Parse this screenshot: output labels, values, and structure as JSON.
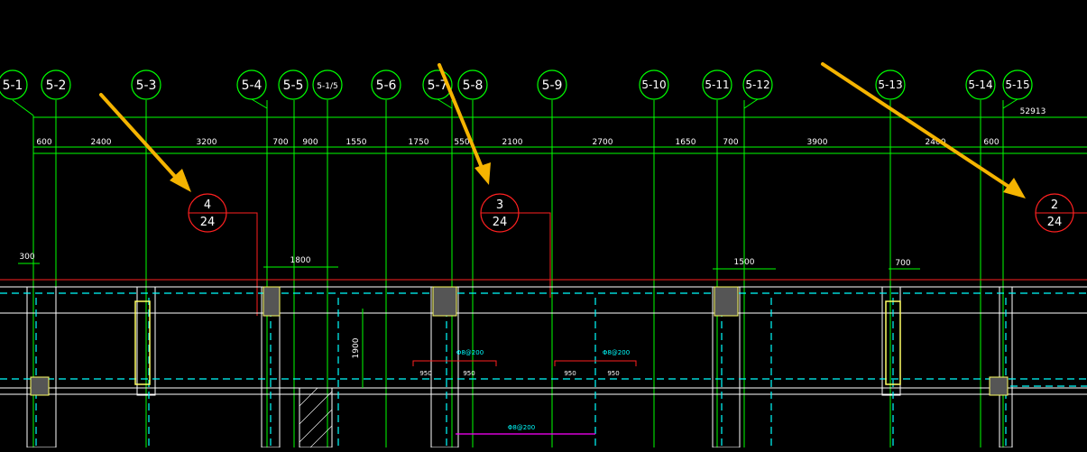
{
  "colors": {
    "background": "#000000",
    "grid": "#00ff00",
    "wall": "#ffffff",
    "dashed": "#00ffff",
    "column": "#ffff66",
    "section": "#ff2020",
    "arrow": "#f5b400",
    "rebar": "#00ffff",
    "magenta": "#ff00ff"
  },
  "axes": [
    "5-1",
    "5-2",
    "5-3",
    "5-4",
    "5-5",
    "5-1/5",
    "5-6",
    "5-7",
    "5-8",
    "5-9",
    "5-10",
    "5-11",
    "5-12",
    "5-13",
    "5-14",
    "5-15"
  ],
  "spacings": [
    "600",
    "2400",
    "3200",
    "700",
    "900",
    "1550",
    "1750",
    "550",
    "2100",
    "2700",
    "1650",
    "700",
    "3900",
    "2400",
    "600"
  ],
  "total_dimension": "52913",
  "section_refs": [
    {
      "num": "4",
      "sheet": "24"
    },
    {
      "num": "3",
      "sheet": "24"
    },
    {
      "num": "2",
      "sheet": "24"
    }
  ],
  "local_dims": {
    "d300": "300",
    "d1800": "1800",
    "d1500": "1500",
    "d700": "700",
    "d1900": "1900"
  },
  "rebar_labels": [
    "Φ8@200",
    "Φ8@200",
    "Φ8@200"
  ],
  "sub_dims": [
    "950",
    "950",
    "950",
    "950"
  ]
}
